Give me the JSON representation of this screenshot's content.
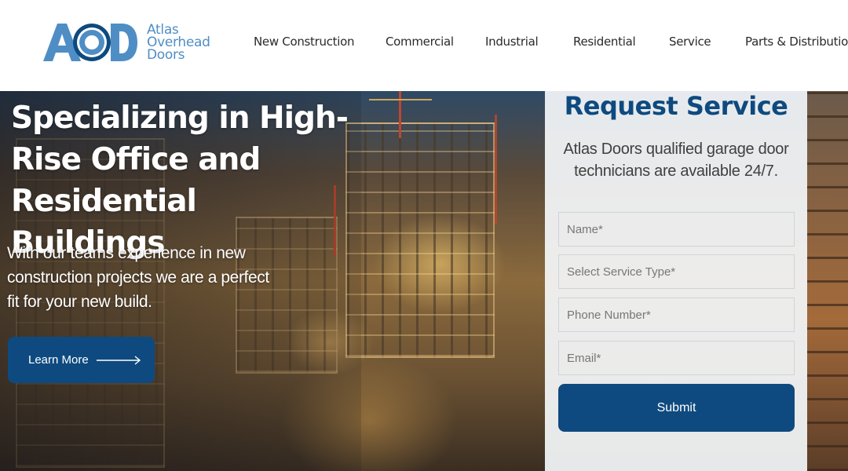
{
  "brand": {
    "logo_mark": "AOD",
    "name_lines": [
      "Atlas",
      "Overhead",
      "Doors"
    ],
    "colors": {
      "primary": "#0e4a7f",
      "logo_blue": "#4f8ec5"
    }
  },
  "nav": {
    "items": [
      {
        "label": "New Construction"
      },
      {
        "label": "Commercial"
      },
      {
        "label": "Industrial"
      },
      {
        "label": "Residential"
      },
      {
        "label": "Service"
      },
      {
        "label": "Parts & Distribution"
      }
    ]
  },
  "hero": {
    "headline": "Specializing in High-Rise Office and Residential Buildings",
    "subtext": "With our teams experience in new construction projects we are a perfect fit for your new build.",
    "cta_label": "Learn More",
    "cta_icon": "arrow-right-icon"
  },
  "service_form": {
    "title": "Request Service",
    "subtitle": "Atlas Doors qualified garage door technicians are available 24/7.",
    "fields": [
      {
        "placeholder": "Name*",
        "value": ""
      },
      {
        "placeholder": "Select Service Type*",
        "value": ""
      },
      {
        "placeholder": "Phone Number*",
        "value": ""
      },
      {
        "placeholder": "Email*",
        "value": ""
      }
    ],
    "submit_label": "Submit"
  }
}
